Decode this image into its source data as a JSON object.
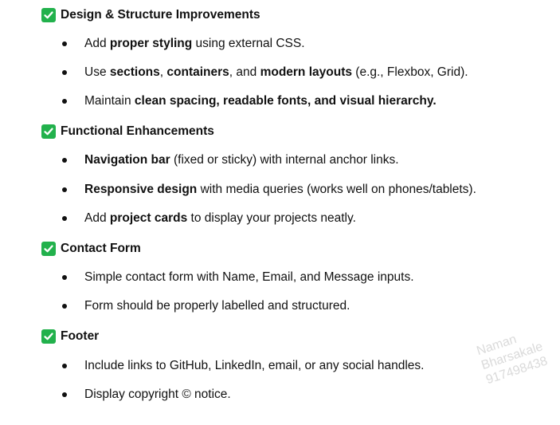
{
  "colors": {
    "check": "#22b14c",
    "text": "#111111",
    "watermark": "#b0b0b0"
  },
  "sections": [
    {
      "title": "Design & Structure Improvements",
      "icon": "checkmark-box-icon",
      "items": [
        [
          {
            "t": "Add ",
            "b": false
          },
          {
            "t": "proper styling",
            "b": true
          },
          {
            "t": " using external CSS.",
            "b": false
          }
        ],
        [
          {
            "t": "Use ",
            "b": false
          },
          {
            "t": "sections",
            "b": true
          },
          {
            "t": ", ",
            "b": false
          },
          {
            "t": "containers",
            "b": true
          },
          {
            "t": ", and ",
            "b": false
          },
          {
            "t": "modern layouts",
            "b": true
          },
          {
            "t": " (e.g., Flexbox, Grid).",
            "b": false
          }
        ],
        [
          {
            "t": "Maintain ",
            "b": false
          },
          {
            "t": "clean spacing, readable fonts, and visual hierarchy.",
            "b": true
          }
        ]
      ]
    },
    {
      "title": "Functional Enhancements",
      "icon": "checkmark-box-icon",
      "items": [
        [
          {
            "t": "Navigation bar",
            "b": true
          },
          {
            "t": " (fixed or sticky) with internal anchor links.",
            "b": false
          }
        ],
        [
          {
            "t": "Responsive design",
            "b": true
          },
          {
            "t": " with media queries (works well on phones/tablets).",
            "b": false
          }
        ],
        [
          {
            "t": "Add ",
            "b": false
          },
          {
            "t": "project cards",
            "b": true
          },
          {
            "t": " to display your projects neatly.",
            "b": false
          }
        ]
      ]
    },
    {
      "title": "Contact Form",
      "icon": "checkmark-box-icon",
      "items": [
        [
          {
            "t": "Simple contact form with Name, Email, and Message inputs.",
            "b": false
          }
        ],
        [
          {
            "t": "Form should be properly labelled and structured.",
            "b": false
          }
        ]
      ]
    },
    {
      "title": "Footer",
      "icon": "checkmark-box-icon",
      "items": [
        [
          {
            "t": "Include links to GitHub, LinkedIn, email, or any social handles.",
            "b": false
          }
        ],
        [
          {
            "t": "Display copyright © notice.",
            "b": false
          }
        ]
      ]
    }
  ],
  "watermark": {
    "lines": [
      "Naman",
      "Bharsakale",
      "917498438"
    ]
  }
}
